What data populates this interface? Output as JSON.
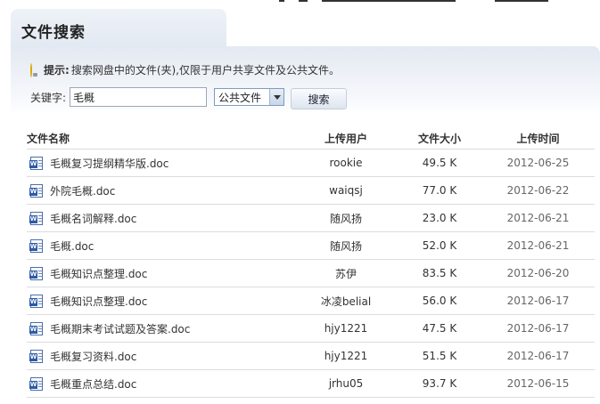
{
  "page": {
    "title": "文件搜索"
  },
  "tip": {
    "label": "提示:",
    "text": "搜索网盘中的文件(夹),仅限于用户共享文件及公共文件。"
  },
  "search": {
    "keyword_label": "关键字:",
    "keyword_value": "毛概",
    "scope_value": "公共文件",
    "button_label": "搜索"
  },
  "table": {
    "headers": {
      "name": "文件名称",
      "user": "上传用户",
      "size": "文件大小",
      "time": "上传时间"
    },
    "rows": [
      {
        "name": "毛概复习提纲精华版.doc",
        "user": "rookie",
        "size": "49.5 K",
        "time": "2012-06-25"
      },
      {
        "name": "外院毛概.doc",
        "user": "waiqsj",
        "size": "77.0 K",
        "time": "2012-06-22"
      },
      {
        "name": "毛概名词解释.doc",
        "user": "随风扬",
        "size": "23.0 K",
        "time": "2012-06-21"
      },
      {
        "name": "毛概.doc",
        "user": "随风扬",
        "size": "52.0 K",
        "time": "2012-06-21"
      },
      {
        "name": "毛概知识点整理.doc",
        "user": "苏伊",
        "size": "83.5 K",
        "time": "2012-06-20"
      },
      {
        "name": "毛概知识点整理.doc",
        "user": "冰凌belial",
        "size": "56.0 K",
        "time": "2012-06-17"
      },
      {
        "name": "毛概期末考试试题及答案.doc",
        "user": "hjy1221",
        "size": "47.5 K",
        "time": "2012-06-17"
      },
      {
        "name": "毛概复习资料.doc",
        "user": "hjy1221",
        "size": "51.5 K",
        "time": "2012-06-17"
      },
      {
        "name": "毛概重点总结.doc",
        "user": "jrhu05",
        "size": "93.7 K",
        "time": "2012-06-15"
      }
    ]
  },
  "icons": {
    "tip": "lightbulb-icon",
    "file": "word-doc-icon",
    "dropdown": "chevron-down-icon"
  },
  "colors": {
    "panel_bg": "#e3e9f2",
    "row_divider": "#dcdcdc",
    "icon_blue": "#2b5aa8"
  }
}
